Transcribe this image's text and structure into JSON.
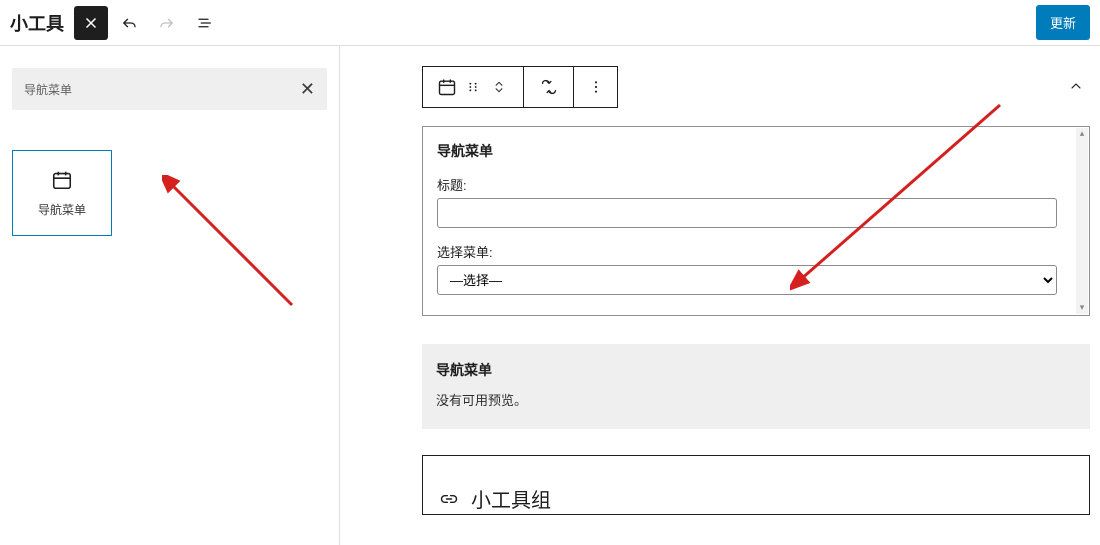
{
  "header": {
    "title": "小工具",
    "update_label": "更新"
  },
  "left": {
    "search_label": "导航菜单",
    "tile_label": "导航菜单"
  },
  "config": {
    "heading": "导航菜单",
    "title_label": "标题:",
    "select_label": "选择菜单:",
    "select_placeholder": "—选择—"
  },
  "preview": {
    "heading": "导航菜单",
    "body": "没有可用预览。"
  },
  "group": {
    "label": "小工具组"
  }
}
